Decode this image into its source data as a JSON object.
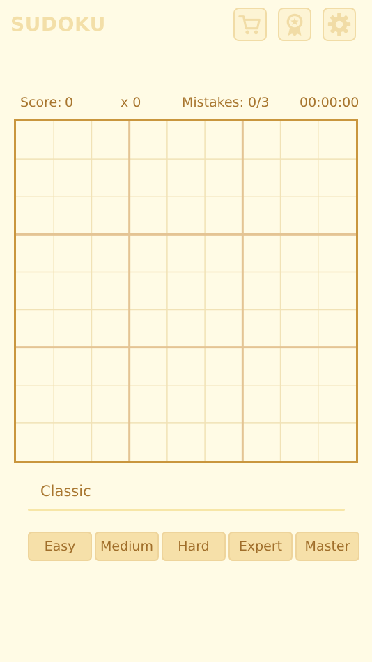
{
  "header": {
    "title": "SUDOKU",
    "buttons": [
      {
        "name": "shop",
        "icon": "cart-icon"
      },
      {
        "name": "achievements",
        "icon": "badge-icon"
      },
      {
        "name": "settings",
        "icon": "gear-icon"
      }
    ]
  },
  "stats": {
    "score_label": "Score:",
    "score_value": "0",
    "combo": "x 0",
    "mistakes": "Mistakes: 0/3",
    "timer": "00:00:00"
  },
  "board": {
    "size": 9,
    "cells": [
      [
        "",
        "",
        "",
        "",
        "",
        "",
        "",
        "",
        ""
      ],
      [
        "",
        "",
        "",
        "",
        "",
        "",
        "",
        "",
        ""
      ],
      [
        "",
        "",
        "",
        "",
        "",
        "",
        "",
        "",
        ""
      ],
      [
        "",
        "",
        "",
        "",
        "",
        "",
        "",
        "",
        ""
      ],
      [
        "",
        "",
        "",
        "",
        "",
        "",
        "",
        "",
        ""
      ],
      [
        "",
        "",
        "",
        "",
        "",
        "",
        "",
        "",
        ""
      ],
      [
        "",
        "",
        "",
        "",
        "",
        "",
        "",
        "",
        ""
      ],
      [
        "",
        "",
        "",
        "",
        "",
        "",
        "",
        "",
        ""
      ],
      [
        "",
        "",
        "",
        "",
        "",
        "",
        "",
        "",
        ""
      ]
    ]
  },
  "mode": {
    "label": "Classic"
  },
  "difficulties": [
    "Easy",
    "Medium",
    "Hard",
    "Expert",
    "Master"
  ],
  "colors": {
    "background": "#fffbe5",
    "accent": "#c9963e",
    "text": "#a8762f",
    "button_bg": "#f6e0a9",
    "icon": "#f1dca6"
  }
}
